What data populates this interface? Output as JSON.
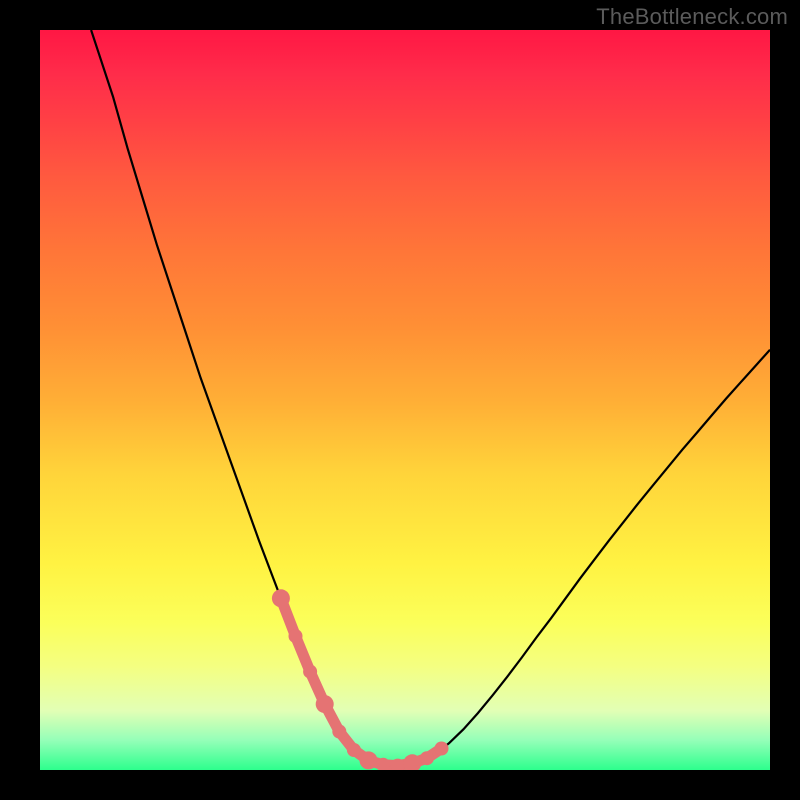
{
  "watermark": "TheBottleneck.com",
  "colors": {
    "accent_dots": "#e57373",
    "curve": "#000000"
  },
  "chart_data": {
    "type": "line",
    "title": "",
    "xlabel": "",
    "ylabel": "",
    "xlim": [
      0,
      100
    ],
    "ylim": [
      0,
      100
    ],
    "x": [
      7,
      8,
      10,
      12,
      14,
      16,
      18,
      20,
      22,
      24,
      26,
      28,
      30,
      32,
      33,
      34,
      35,
      36,
      37,
      38,
      39,
      40,
      41,
      42,
      43,
      44,
      45,
      46,
      47,
      48,
      49,
      50,
      52,
      54,
      56,
      58,
      60,
      62,
      64,
      66,
      68,
      70,
      72,
      74,
      76,
      78,
      80,
      82,
      84,
      86,
      88,
      90,
      92,
      94,
      96,
      98,
      100
    ],
    "y": [
      100,
      97,
      91,
      84,
      77.5,
      71,
      65,
      59,
      53,
      47.5,
      42,
      36.5,
      31,
      25.8,
      23.2,
      20.6,
      18.1,
      15.7,
      13.3,
      11,
      8.9,
      6.9,
      5.2,
      3.8,
      2.7,
      1.9,
      1.3,
      0.9,
      0.7,
      0.6,
      0.6,
      0.7,
      1.1,
      2.1,
      3.6,
      5.5,
      7.7,
      10.1,
      12.6,
      15.2,
      17.9,
      20.5,
      23.2,
      25.9,
      28.5,
      31.1,
      33.6,
      36.1,
      38.5,
      40.9,
      43.3,
      45.6,
      47.9,
      50.2,
      52.4,
      54.6,
      56.8
    ],
    "bottom_highlight": {
      "x": [
        33,
        35,
        37,
        39,
        41,
        43,
        45,
        47,
        49,
        51,
        53,
        55
      ],
      "y": [
        23.2,
        18.1,
        13.3,
        8.9,
        5.2,
        2.7,
        1.3,
        0.7,
        0.6,
        0.9,
        1.6,
        2.9
      ]
    }
  }
}
